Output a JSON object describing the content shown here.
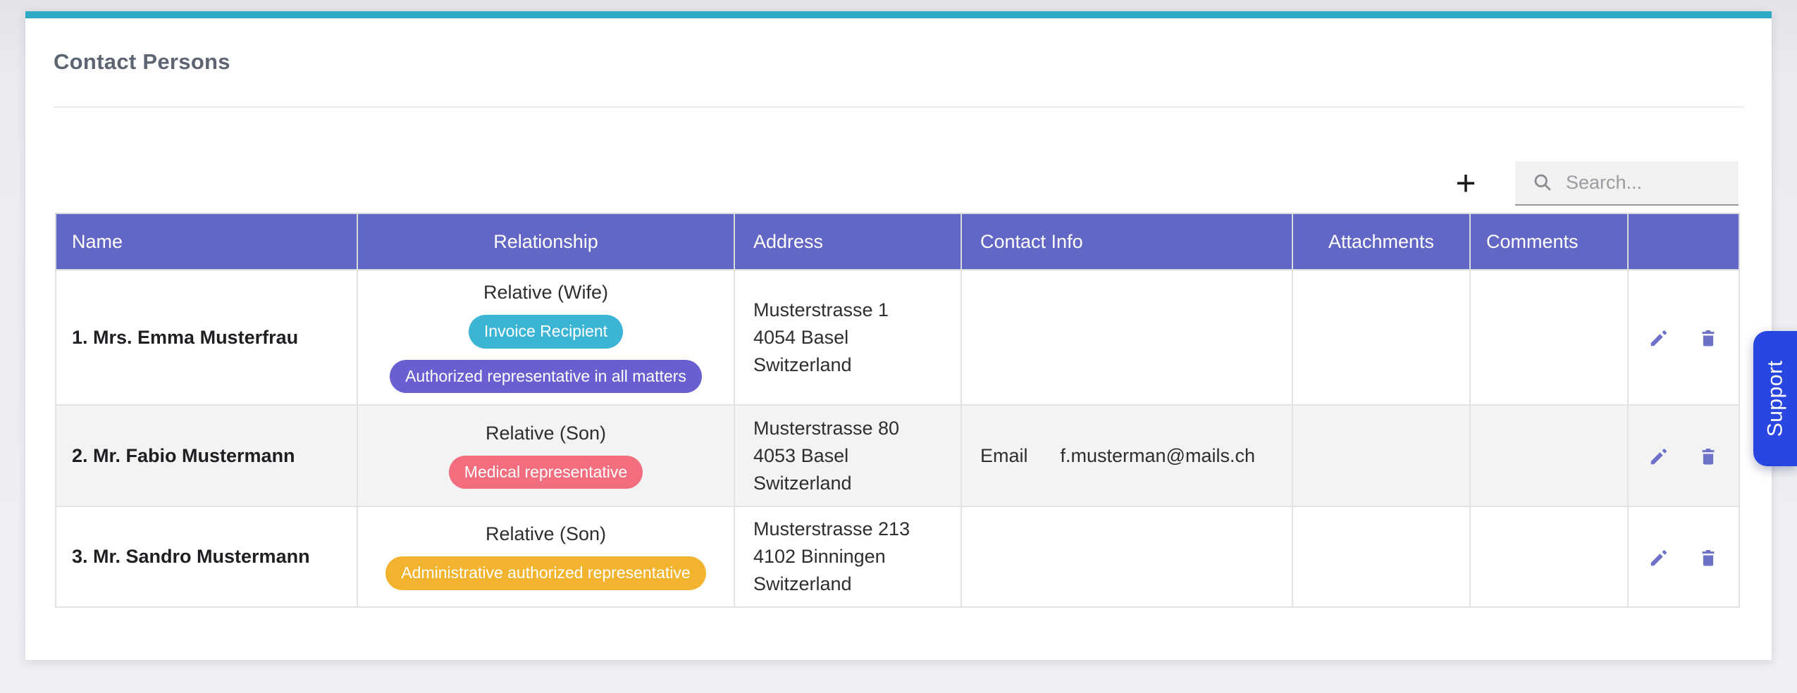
{
  "page": {
    "title": "Contact Persons",
    "support_label": "Support"
  },
  "toolbar": {
    "add_label": "+",
    "search_placeholder": "Search...",
    "search_value": ""
  },
  "table": {
    "columns": [
      "Name",
      "Relationship",
      "Address",
      "Contact Info",
      "Attachments",
      "Comments",
      ""
    ],
    "rows": [
      {
        "name": "1. Mrs. Emma Musterfrau",
        "relationship": "Relative (Wife)",
        "badges": [
          {
            "label": "Invoice Recipient",
            "color": "#3cb4d4"
          },
          {
            "label": "Authorized representative in all matters",
            "color": "#6a5fd0"
          }
        ],
        "address_lines": [
          "Musterstrasse 1",
          "4054 Basel",
          "Switzerland"
        ],
        "contact": null,
        "attachments": "",
        "comments": ""
      },
      {
        "name": "2. Mr. Fabio Mustermann",
        "relationship": "Relative (Son)",
        "badges": [
          {
            "label": "Medical representative",
            "color": "#f26d7e"
          }
        ],
        "address_lines": [
          "Musterstrasse 80",
          "4053 Basel",
          "Switzerland"
        ],
        "contact": {
          "type": "Email",
          "value": "f.musterman@mails.ch"
        },
        "attachments": "",
        "comments": ""
      },
      {
        "name": "3. Mr. Sandro Mustermann",
        "relationship": "Relative (Son)",
        "badges": [
          {
            "label": "Administrative authorized representative",
            "color": "#f2b42e"
          }
        ],
        "address_lines": [
          "Musterstrasse 213",
          "4102 Binningen",
          "Switzerland"
        ],
        "contact": null,
        "attachments": "",
        "comments": ""
      }
    ]
  },
  "colors": {
    "accent_bar": "#2ea9c4",
    "table_header_bg": "#6266c4",
    "support_button_bg": "#2a46e0",
    "action_icon": "#6e71c8",
    "badge_teal": "#3cb4d4",
    "badge_purple": "#6a5fd0",
    "badge_coral": "#f26d7e",
    "badge_amber": "#f2b42e"
  }
}
